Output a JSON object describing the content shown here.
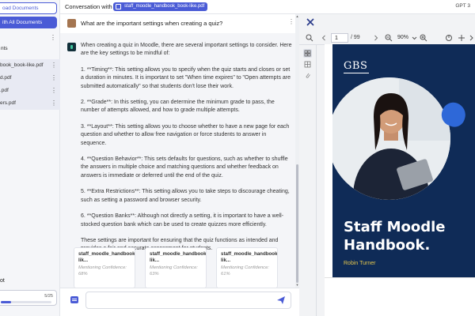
{
  "sidebar": {
    "upload_label": "oad Documents",
    "chat_all_label": "ith All Documents",
    "section_label": "nts",
    "files": [
      {
        "name": "book_book-like.pdf",
        "active": true
      },
      {
        "name": "d.pdf",
        "active": true
      },
      {
        "name": ".pdf",
        "active": true
      },
      {
        "name": "ers.pdf",
        "active": true
      }
    ],
    "chatbot_label": "ot",
    "usage_count": "5/25",
    "usage_progress": 0.2
  },
  "header": {
    "conversation_label": "Conversation with",
    "file_chip": "staff_moodle_handbook_book-like.pdf",
    "model_label": "GPT 3"
  },
  "chat": {
    "user_question": "What are the important settings when creating a quiz?",
    "answer_paragraphs": [
      "When creating a quiz in Moodle, there are several important settings to consider. Here are the key settings to be mindful of:",
      "1. **Timing**: This setting allows you to specify when the quiz starts and closes or set a duration in minutes. It is important to set \"When time expires\" to \"Open attempts are submitted automatically\" so that students don't lose their work.",
      "2. **Grade**: In this setting, you can determine the minimum grade to pass, the number of attempts allowed, and how to grade multiple attempts.",
      "3. **Layout**: This setting allows you to choose whether to have a new page for each question and whether to allow free navigation or force students to answer in sequence.",
      "4. **Question Behavior**: This sets defaults for questions, such as whether to shuffle the answers in multiple choice and matching questions and whether feedback on answers is immediate or deferred until the end of the quiz.",
      "5. **Extra Restrictions**: This setting allows you to take steps to discourage cheating, such as setting a password and browser security.",
      "6. **Question Banks**: Although not directly a setting, it is important to have a well-stocked question bank which can be used to create quizzes more efficiently.",
      "These settings are important for ensuring that the quiz functions as intended and provides a fair and accurate assessment for students."
    ],
    "sources": [
      {
        "title": "staff_moodle_handbook_bo lik...",
        "confidence": "Mentioning Confidence: 68%"
      },
      {
        "title": "staff_moodle_handbook_bo lik...",
        "confidence": "Mentioning Confidence: 63%"
      },
      {
        "title": "staff_moodle_handbook_bo lik...",
        "confidence": "Mentioning Confidence: 61%"
      }
    ],
    "input_value": "",
    "input_placeholder": ""
  },
  "viewer": {
    "current_page": "1",
    "total_pages": "/ 99",
    "zoom": "90%",
    "page_logo": "GBS",
    "page_title": "Staff Moodle Handbook.",
    "page_author": "Robin Turner"
  },
  "colors": {
    "accent": "#4a5bd6",
    "cover_bg": "#0f2b57",
    "author_gold": "#e5c64c",
    "blob_blue": "#2e68d8"
  }
}
